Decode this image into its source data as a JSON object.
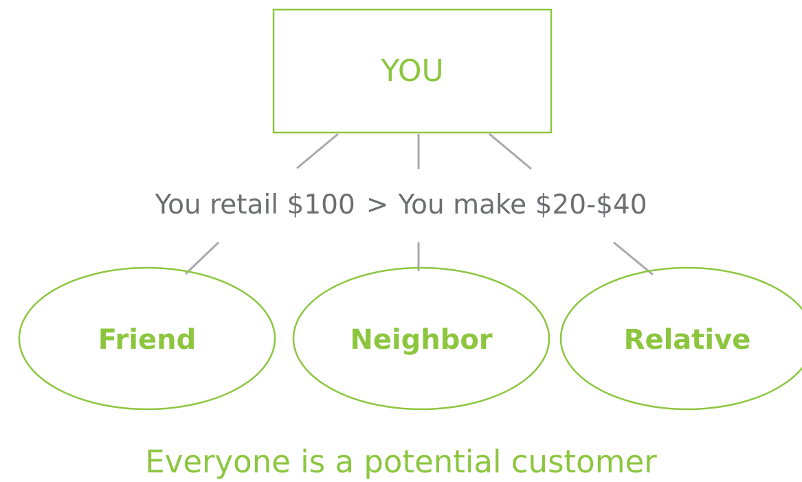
{
  "colors": {
    "accent": "#8cc63f",
    "text_gray": "#6d6e71",
    "connector_gray": "#a7a9ac"
  },
  "top_node": {
    "label": "YOU"
  },
  "middle": {
    "retail": "You retail $100",
    "separator": ">",
    "earnings": "You make $20-$40"
  },
  "customers": [
    {
      "label": "Friend"
    },
    {
      "label": "Neighbor"
    },
    {
      "label": "Relative"
    }
  ],
  "tagline": "Everyone is a potential customer"
}
